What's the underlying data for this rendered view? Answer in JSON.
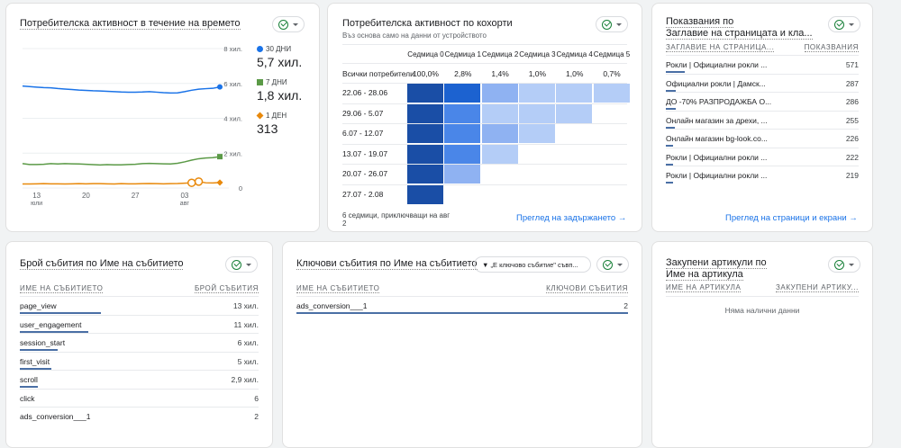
{
  "activity": {
    "title": "Потребителска активност в течение на времето",
    "y_ticks": [
      "8 хил.",
      "6 хил.",
      "4 хил.",
      "2 хил.",
      "0"
    ],
    "x_ticks": [
      {
        "day": "13",
        "month": "юли"
      },
      {
        "day": "20",
        "month": ""
      },
      {
        "day": "27",
        "month": ""
      },
      {
        "day": "03",
        "month": "авг"
      }
    ],
    "legend": [
      {
        "label": "30 ДНИ",
        "value": "5,7 хил.",
        "color": "#1a73e8",
        "marker": "circle"
      },
      {
        "label": "7 ДНИ",
        "value": "1,8 хил.",
        "color": "#5b9a47",
        "marker": "square"
      },
      {
        "label": "1 ДЕН",
        "value": "313",
        "color": "#e8890c",
        "marker": "diamond"
      }
    ],
    "chart_data": {
      "type": "line",
      "x_start": "11.07",
      "x_end": "08.08",
      "ylim": [
        0,
        8000
      ],
      "grid": true,
      "series": [
        {
          "name": "30 ДНИ",
          "values": [
            5850,
            5820,
            5790,
            5760,
            5750,
            5710,
            5680,
            5650,
            5620,
            5600,
            5580,
            5570,
            5550,
            5530,
            5510,
            5500,
            5500,
            5510,
            5530,
            5500,
            5470,
            5450,
            5460,
            5530,
            5610,
            5670,
            5700,
            5720,
            5800
          ]
        },
        {
          "name": "7 ДНИ",
          "values": [
            1400,
            1350,
            1350,
            1360,
            1400,
            1380,
            1400,
            1390,
            1380,
            1360,
            1340,
            1320,
            1340,
            1330,
            1330,
            1350,
            1360,
            1400,
            1410,
            1400,
            1390,
            1380,
            1420,
            1500,
            1600,
            1680,
            1720,
            1740,
            1800
          ]
        },
        {
          "name": "1 ДЕН",
          "values": [
            230,
            230,
            240,
            250,
            240,
            240,
            230,
            240,
            250,
            240,
            250,
            250,
            240,
            230,
            250,
            240,
            240,
            250,
            260,
            250,
            240,
            250,
            260,
            280,
            300,
            370,
            300,
            290,
            313
          ],
          "anomalies": [
            24,
            25
          ]
        }
      ]
    }
  },
  "cohort": {
    "title": "Потребителска активност по кохорти",
    "subtitle": "Въз основа само на данни от устройството",
    "columns": [
      "Седмица 0",
      "Седмица 1",
      "Седмица 2",
      "Седмица 3",
      "Седмица 4",
      "Седмица 5"
    ],
    "all_label": "Всички потребители",
    "all_values": [
      "100,0%",
      "2,8%",
      "1,4%",
      "1,0%",
      "1,0%",
      "0,7%"
    ],
    "rows": [
      {
        "label": "22.06 - 28.06",
        "levels": [
          5,
          4,
          2,
          1,
          1,
          1
        ]
      },
      {
        "label": "29.06 - 5.07",
        "levels": [
          5,
          3,
          1,
          1,
          1
        ]
      },
      {
        "label": "6.07 - 12.07",
        "levels": [
          5,
          3,
          2,
          1
        ]
      },
      {
        "label": "13.07 - 19.07",
        "levels": [
          5,
          3,
          1
        ]
      },
      {
        "label": "20.07 - 26.07",
        "levels": [
          5,
          2
        ]
      },
      {
        "label": "27.07 - 2.08",
        "levels": [
          5
        ]
      }
    ],
    "colors": [
      "#ffffff",
      "#b4cdf7",
      "#8fb2f2",
      "#4a86e8",
      "#1c62d0",
      "#1a4ea6"
    ],
    "footer": "6 седмици, приключващи на авг 2",
    "link": "Преглед на задържането"
  },
  "views": {
    "title1": "Показвания по",
    "title2": "Заглавие на страницата и кла...",
    "col1": "ЗАГЛАВИЕ НА СТРАНИЦА...",
    "col2": "ПОКАЗВАНИЯ",
    "rows": [
      {
        "name": "Рокли | Официални рокли ...",
        "value": "571",
        "num": 571
      },
      {
        "name": "Официални рокли | Дамск...",
        "value": "287",
        "num": 287
      },
      {
        "name": "ДО -70% РАЗПРОДАЖБА О...",
        "value": "286",
        "num": 286
      },
      {
        "name": "Онлайн магазин за дрехи, ...",
        "value": "255",
        "num": 255
      },
      {
        "name": "Онлайн магазин bg-look.co...",
        "value": "226",
        "num": 226
      },
      {
        "name": "Рокли | Официални рокли ...",
        "value": "222",
        "num": 222
      },
      {
        "name": "Рокли | Официални рокли ...",
        "value": "219",
        "num": 219
      }
    ],
    "link": "Преглед на страници и екрани"
  },
  "events": {
    "title": "Брой събития по Име на събитието",
    "col1": "ИМЕ НА СЪБИТИЕТО",
    "col2": "БРОЙ СЪБИТИЯ",
    "rows": [
      {
        "name": "page_view",
        "value": "13 хил.",
        "num": 13000
      },
      {
        "name": "user_engagement",
        "value": "11 хил.",
        "num": 11000
      },
      {
        "name": "session_start",
        "value": "6 хил.",
        "num": 6000
      },
      {
        "name": "first_visit",
        "value": "5 хил.",
        "num": 5000
      },
      {
        "name": "scroll",
        "value": "2,9 хил.",
        "num": 2900
      },
      {
        "name": "click",
        "value": "6",
        "num": 6
      },
      {
        "name": "ads_conversion___1",
        "value": "2",
        "num": 2
      }
    ]
  },
  "key_events": {
    "title": "Ключови събития по Име на събитието",
    "filter": "„Е ключово събитие\" съвп...",
    "col1": "ИМЕ НА СЪБИТИЕТО",
    "col2": "КЛЮЧОВИ СЪБИТИЯ",
    "rows": [
      {
        "name": "ads_conversion___1",
        "value": "2",
        "num": 2
      }
    ]
  },
  "items": {
    "title1": "Закупени артикули по",
    "title2": "Име на артикула",
    "col1": "ИМЕ НА АРТИКУЛА",
    "col2": "ЗАКУПЕНИ АРТИКУ...",
    "empty": "Няма налични данни"
  }
}
